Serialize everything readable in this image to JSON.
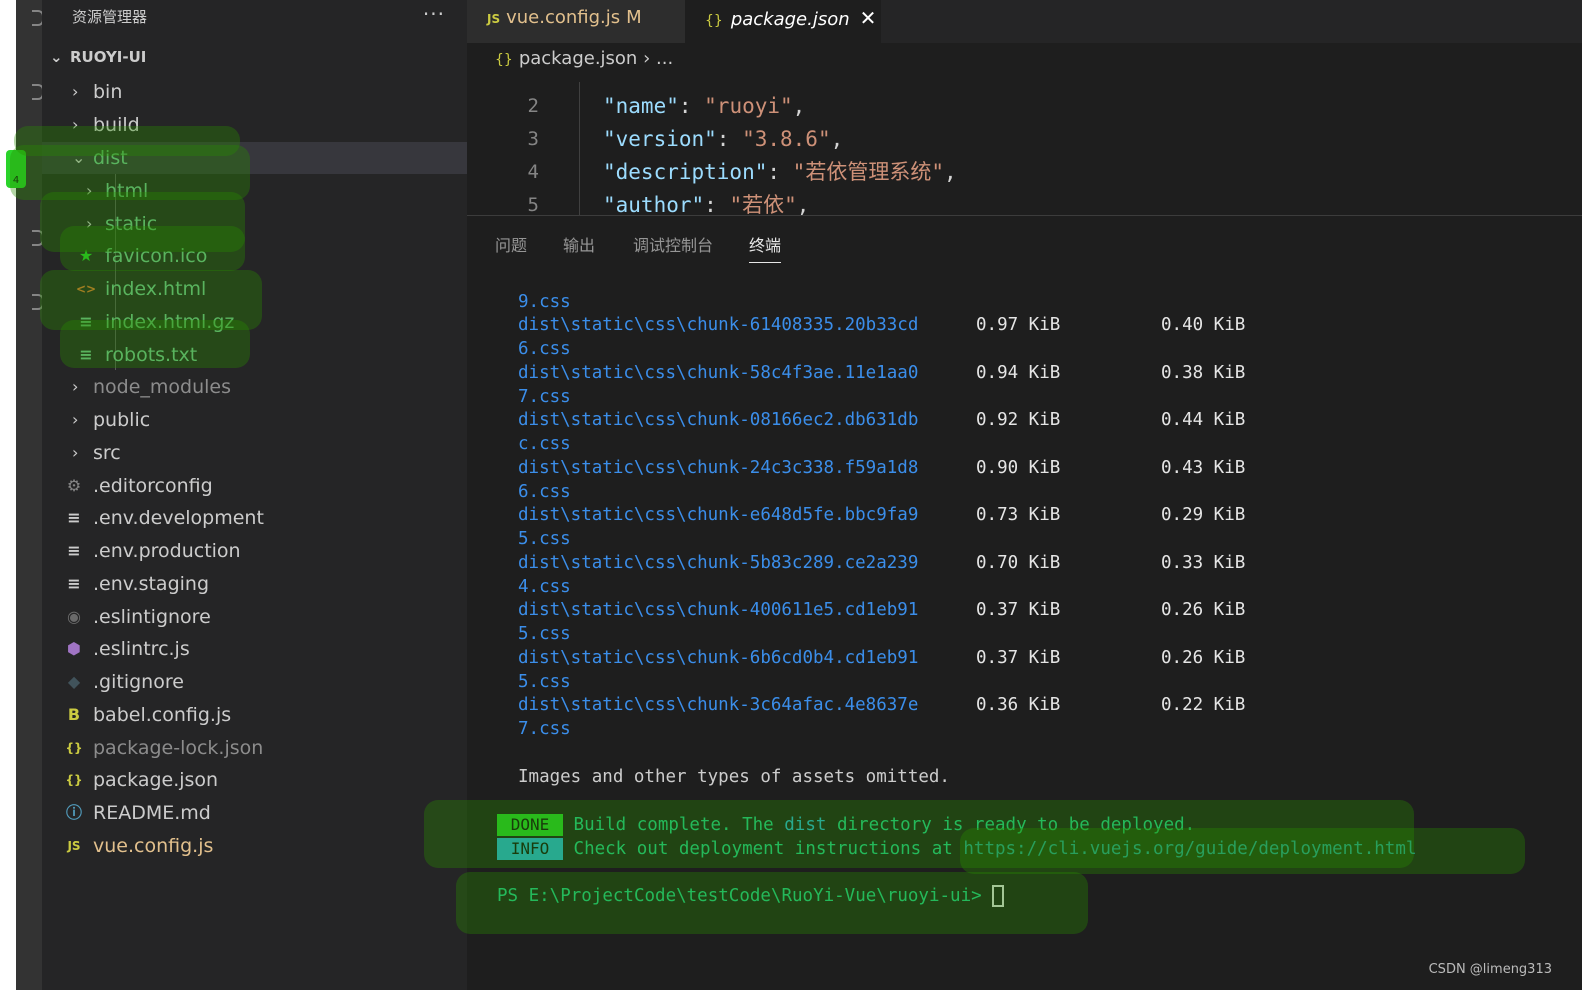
{
  "sidebar": {
    "title": "资源管理器",
    "more": "···",
    "root": "RUOYI-UI",
    "items": [
      {
        "label": "bin",
        "chev": "›",
        "icon": ""
      },
      {
        "label": "build",
        "chev": "›",
        "icon": ""
      },
      {
        "label": "dist",
        "chev": "⌄",
        "icon": ""
      },
      {
        "label": "html",
        "chev": "›",
        "icon": ""
      },
      {
        "label": "static",
        "chev": "›",
        "icon": ""
      },
      {
        "label": "favicon.ico",
        "chev": "",
        "icon": "★"
      },
      {
        "label": "index.html",
        "chev": "",
        "icon": "<>"
      },
      {
        "label": "index.html.gz",
        "chev": "",
        "icon": "≡"
      },
      {
        "label": "robots.txt",
        "chev": "",
        "icon": "≡"
      },
      {
        "label": "node_modules",
        "chev": "›",
        "icon": ""
      },
      {
        "label": "public",
        "chev": "›",
        "icon": ""
      },
      {
        "label": "src",
        "chev": "›",
        "icon": ""
      },
      {
        "label": ".editorconfig",
        "chev": "",
        "icon": "⚙"
      },
      {
        "label": ".env.development",
        "chev": "",
        "icon": "≡"
      },
      {
        "label": ".env.production",
        "chev": "",
        "icon": "≡"
      },
      {
        "label": ".env.staging",
        "chev": "",
        "icon": "≡"
      },
      {
        "label": ".eslintignore",
        "chev": "",
        "icon": "◉"
      },
      {
        "label": ".eslintrc.js",
        "chev": "",
        "icon": "⬢"
      },
      {
        "label": ".gitignore",
        "chev": "",
        "icon": "◆"
      },
      {
        "label": "babel.config.js",
        "chev": "",
        "icon": "B"
      },
      {
        "label": "package-lock.json",
        "chev": "",
        "icon": "{}"
      },
      {
        "label": "package.json",
        "chev": "",
        "icon": "{}"
      },
      {
        "label": "README.md",
        "chev": "",
        "icon": "ⓘ"
      },
      {
        "label": "vue.config.js",
        "chev": "",
        "icon": "JS"
      }
    ],
    "git_status": "M"
  },
  "tabs": {
    "tab1": {
      "icon": "JS",
      "label": "vue.config.js",
      "status": "M"
    },
    "tab2": {
      "icon": "{}",
      "label": "package.json",
      "close": "✕"
    }
  },
  "breadcrumb": {
    "icon": "{}",
    "file": "package.json",
    "sep": "›",
    "rest": "..."
  },
  "code": {
    "lines": [
      {
        "n": "2",
        "key": "\"name\"",
        "val": "\"ruoyi\""
      },
      {
        "n": "3",
        "key": "\"version\"",
        "val": "\"3.8.6\""
      },
      {
        "n": "4",
        "key": "\"description\"",
        "val": "\"若依管理系统\""
      },
      {
        "n": "5",
        "key": "\"author\"",
        "val": "\"若依\""
      }
    ]
  },
  "panel": {
    "tabs": [
      "问题",
      "输出",
      "调试控制台",
      "终端"
    ],
    "active_tab": "终端"
  },
  "terminal": {
    "first_line": "9.css",
    "assets": [
      {
        "path": "dist\\static\\css\\chunk-61408335.20b33cd",
        "tail": "6.css",
        "size": "0.97 KiB",
        "gzip": "0.40 KiB"
      },
      {
        "path": "dist\\static\\css\\chunk-58c4f3ae.11e1aa0",
        "tail": "7.css",
        "size": "0.94 KiB",
        "gzip": "0.38 KiB"
      },
      {
        "path": "dist\\static\\css\\chunk-08166ec2.db631db",
        "tail": "c.css",
        "size": "0.92 KiB",
        "gzip": "0.44 KiB"
      },
      {
        "path": "dist\\static\\css\\chunk-24c3c338.f59a1d8",
        "tail": "6.css",
        "size": "0.90 KiB",
        "gzip": "0.43 KiB"
      },
      {
        "path": "dist\\static\\css\\chunk-e648d5fe.bbc9fa9",
        "tail": "5.css",
        "size": "0.73 KiB",
        "gzip": "0.29 KiB"
      },
      {
        "path": "dist\\static\\css\\chunk-5b83c289.ce2a239",
        "tail": "4.css",
        "size": "0.70 KiB",
        "gzip": "0.33 KiB"
      },
      {
        "path": "dist\\static\\css\\chunk-400611e5.cd1eb91",
        "tail": "5.css",
        "size": "0.37 KiB",
        "gzip": "0.26 KiB"
      },
      {
        "path": "dist\\static\\css\\chunk-6b6cd0b4.cd1eb91",
        "tail": "5.css",
        "size": "0.37 KiB",
        "gzip": "0.26 KiB"
      },
      {
        "path": "dist\\static\\css\\chunk-3c64afac.4e8637e",
        "tail": "7.css",
        "size": "0.36 KiB",
        "gzip": "0.22 KiB"
      }
    ],
    "omitted": "Images and other types of assets omitted.",
    "done_badge": "DONE",
    "done_pre": "Build complete. The ",
    "done_dist": "dist",
    "done_post": " directory is ready to be deployed.",
    "info_badge": "INFO",
    "info_text": "Check out deployment instructions at ",
    "info_url": "https://cli.vuejs.org/guide/deployment.html",
    "prompt": "PS E:\\ProjectCode\\testCode\\RuoYi-Vue\\ruoyi-ui> "
  },
  "watermark": "CSDN @limeng313",
  "colors": {
    "sidebar_bg": "#252526",
    "editor_bg": "#1e1e1e",
    "terminal_blue": "#3b8eea",
    "highlight_green": "#2ad32a"
  }
}
